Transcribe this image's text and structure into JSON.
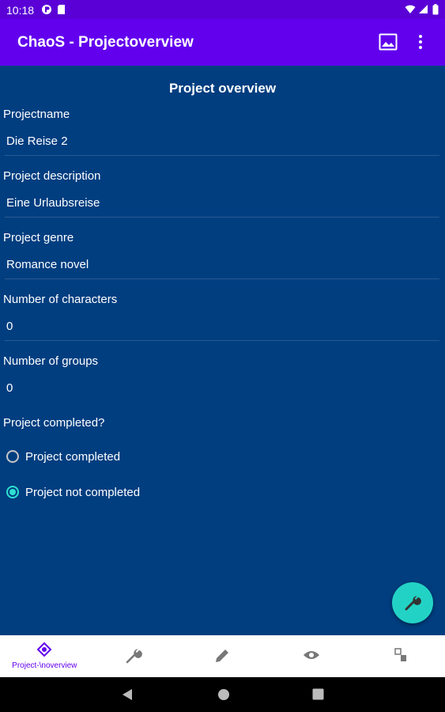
{
  "status_bar": {
    "time": "10:18"
  },
  "toolbar": {
    "title": "ChaoS - Projectoverview"
  },
  "content": {
    "heading": "Project overview",
    "fields": [
      {
        "label": "Projectname",
        "value": "Die Reise 2"
      },
      {
        "label": "Project description",
        "value": "Eine Urlaubsreise"
      },
      {
        "label": "Project genre",
        "value": "Romance novel"
      },
      {
        "label": "Number of characters",
        "value": "0"
      },
      {
        "label": "Number of groups",
        "value": "0"
      }
    ],
    "completed_question": "Project completed?",
    "radios": [
      {
        "label": "Project completed",
        "checked": false
      },
      {
        "label": "Project not completed",
        "checked": true
      }
    ]
  },
  "bottom_nav": {
    "items": [
      {
        "label": "Project-\\noverview",
        "icon": "project-overview-icon",
        "active": true
      },
      {
        "icon": "wrench-icon"
      },
      {
        "icon": "pencil-icon"
      },
      {
        "icon": "eye-icon"
      },
      {
        "icon": "group-icon"
      }
    ]
  },
  "colors": {
    "primary": "#6200ee",
    "status_bar": "#5a00d6",
    "background": "#003e80",
    "accent": "#22d3c5"
  }
}
